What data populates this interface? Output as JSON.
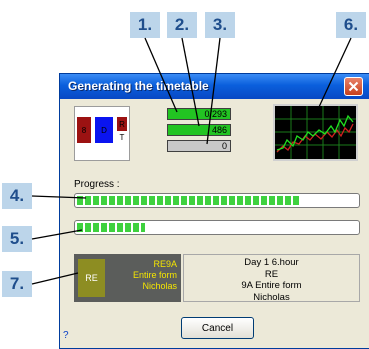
{
  "callouts": [
    "1.",
    "2.",
    "3.",
    "4.",
    "5.",
    "6.",
    "7."
  ],
  "window": {
    "title": "Generating the timetable",
    "close_label": "×"
  },
  "rooms": [
    {
      "label": "8",
      "color": "#9c1212"
    },
    {
      "label": "D",
      "color": "#0a14f0"
    },
    {
      "label": "R",
      "color": "#9c1212"
    },
    {
      "label": "T",
      "color": "#ffffff"
    }
  ],
  "counters": [
    {
      "value": "0/293",
      "fill": 1.0,
      "color": "#22c422"
    },
    {
      "value": "486",
      "fill": 1.0,
      "color": "#22c422"
    },
    {
      "value": "0",
      "fill": 1.0,
      "color": "#c8c8c8"
    }
  ],
  "progress": {
    "label": "Progress :",
    "bar1_fraction": 0.79,
    "bar2_fraction": 0.24,
    "color": "#3ed13e"
  },
  "lesson_card": {
    "short": "RE",
    "lines": [
      "RE9A",
      "Entire form",
      "Nicholas"
    ]
  },
  "detail": {
    "lines": [
      "Day 1 6.hour",
      "RE",
      "9A Entire form",
      "Nicholas"
    ]
  },
  "help": "?",
  "cancel_label": "Cancel"
}
